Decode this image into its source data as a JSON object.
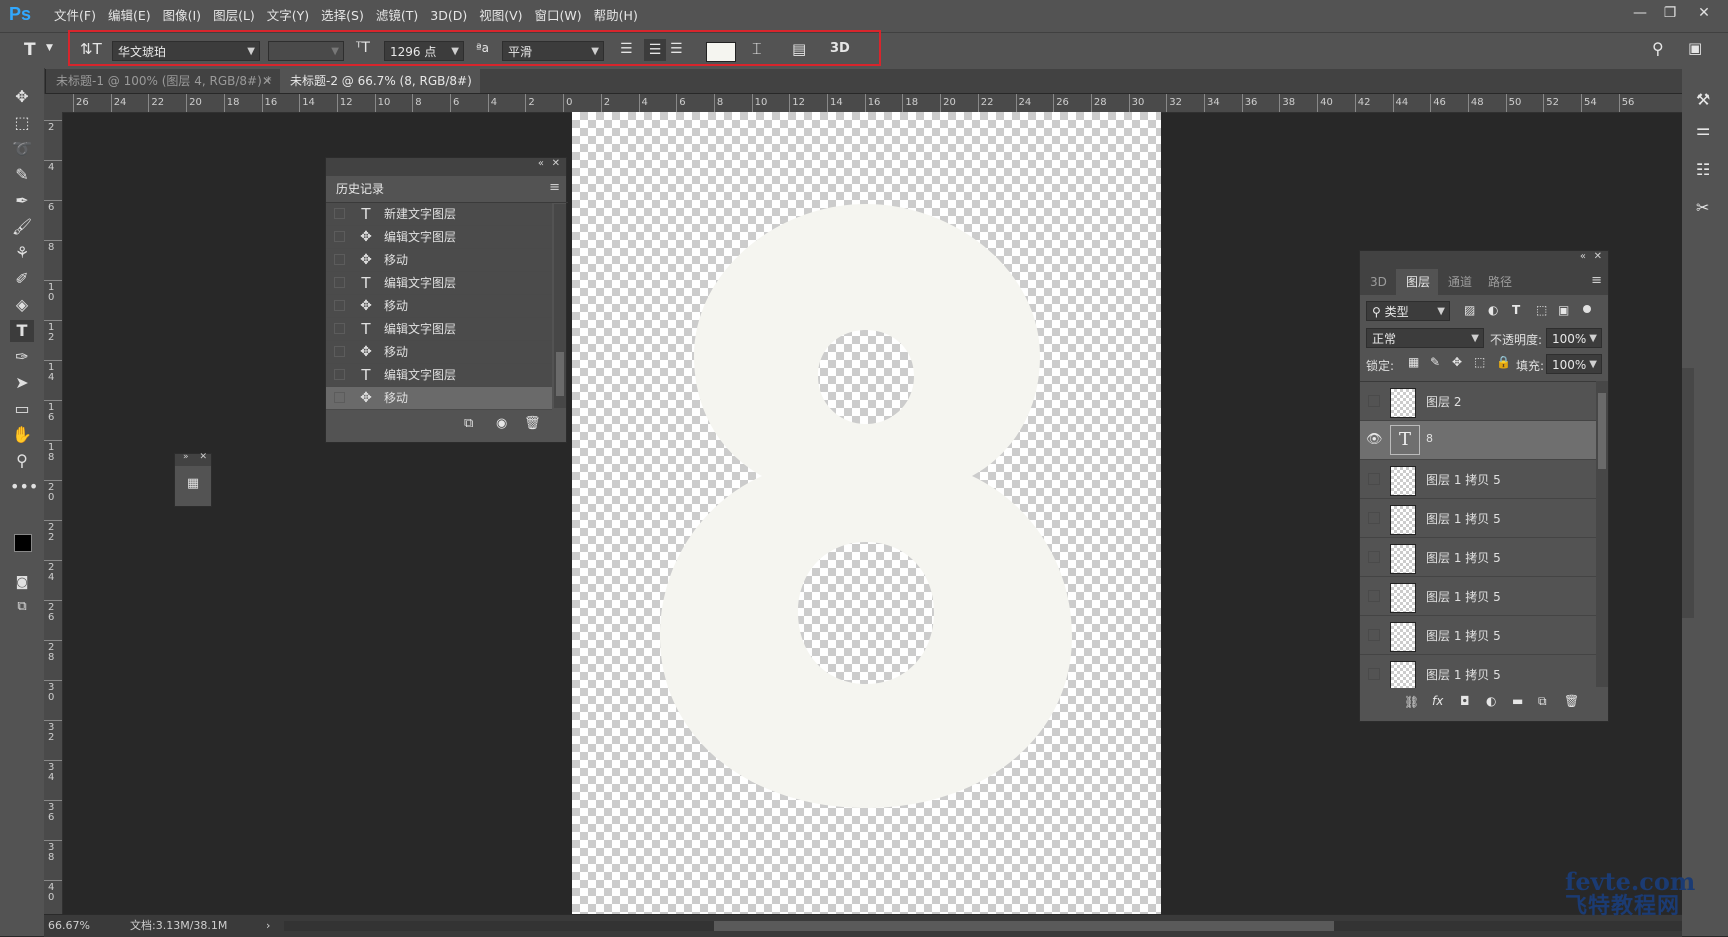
{
  "app": {
    "logo": "Ps"
  },
  "menu": [
    "文件(F)",
    "编辑(E)",
    "图像(I)",
    "图层(L)",
    "文字(Y)",
    "选择(S)",
    "滤镜(T)",
    "3D(D)",
    "视图(V)",
    "窗口(W)",
    "帮助(H)"
  ],
  "window_controls": {
    "minimize": "—",
    "restore": "❐",
    "close": "✕"
  },
  "options": {
    "font_family": "华文琥珀",
    "font_style": "",
    "font_size": "1296 点",
    "antialias": "平滑",
    "text_color": "#f5f5f0",
    "accent_box_color": "#d8252c",
    "three_d": "3D"
  },
  "tabs": [
    {
      "label": "未标题-1 @ 100% (图层 4, RGB/8#) *",
      "active": false
    },
    {
      "label": "未标题-2 @ 66.7% (8, RGB/8#) *",
      "active": true
    }
  ],
  "ruler_h": [
    "26",
    "24",
    "22",
    "20",
    "18",
    "16",
    "14",
    "12",
    "10",
    "8",
    "6",
    "4",
    "2",
    "0",
    "2",
    "4",
    "6",
    "8",
    "10",
    "12",
    "14",
    "16",
    "18",
    "20",
    "22",
    "24",
    "26",
    "28",
    "30",
    "32",
    "34",
    "36",
    "38",
    "40",
    "42",
    "44",
    "46",
    "48",
    "50",
    "52",
    "54",
    "56"
  ],
  "ruler_v": [
    "2",
    "4",
    "6",
    "8",
    "1\n0",
    "1\n2",
    "1\n4",
    "1\n6",
    "1\n8",
    "2\n0",
    "2\n2",
    "2\n4",
    "2\n6",
    "2\n8",
    "3\n0",
    "3\n2",
    "3\n4",
    "3\n6",
    "3\n8",
    "4\n0"
  ],
  "history": {
    "title": "历史记录",
    "items": [
      {
        "icon": "text",
        "label": "新建文字图层"
      },
      {
        "icon": "move",
        "label": "编辑文字图层"
      },
      {
        "icon": "move",
        "label": "移动"
      },
      {
        "icon": "text",
        "label": "编辑文字图层"
      },
      {
        "icon": "move",
        "label": "移动"
      },
      {
        "icon": "text",
        "label": "编辑文字图层"
      },
      {
        "icon": "move",
        "label": "移动"
      },
      {
        "icon": "text",
        "label": "编辑文字图层"
      },
      {
        "icon": "move",
        "label": "移动"
      }
    ]
  },
  "layers_panel": {
    "tabs": [
      "3D",
      "图层",
      "通道",
      "路径"
    ],
    "active_tab": "图层",
    "filter_label": "类型",
    "blend_mode": "正常",
    "opacity_label": "不透明度:",
    "opacity_value": "100%",
    "lock_label": "锁定:",
    "fill_label": "填充:",
    "fill_value": "100%",
    "layers": [
      {
        "name": "图层 2",
        "type": "raster",
        "visible": false,
        "selected": false
      },
      {
        "name": "8",
        "type": "text",
        "visible": true,
        "selected": true
      },
      {
        "name": "图层 1 拷贝 5",
        "type": "raster",
        "visible": false,
        "selected": false
      },
      {
        "name": "图层 1 拷贝 5",
        "type": "raster",
        "visible": false,
        "selected": false
      },
      {
        "name": "图层 1 拷贝 5",
        "type": "raster",
        "visible": false,
        "selected": false
      },
      {
        "name": "图层 1 拷贝 5",
        "type": "raster",
        "visible": false,
        "selected": false
      },
      {
        "name": "图层 1 拷贝 5",
        "type": "raster",
        "visible": false,
        "selected": false
      },
      {
        "name": "图层 1 拷贝 5",
        "type": "raster",
        "visible": false,
        "selected": false
      }
    ]
  },
  "canvas": {
    "glyph_color": "#f5f5f0"
  },
  "status": {
    "zoom": "66.67%",
    "doc": "文档:3.13M/38.1M"
  },
  "watermark": {
    "top": "fevte.com",
    "bottom": "飞特教程网"
  }
}
